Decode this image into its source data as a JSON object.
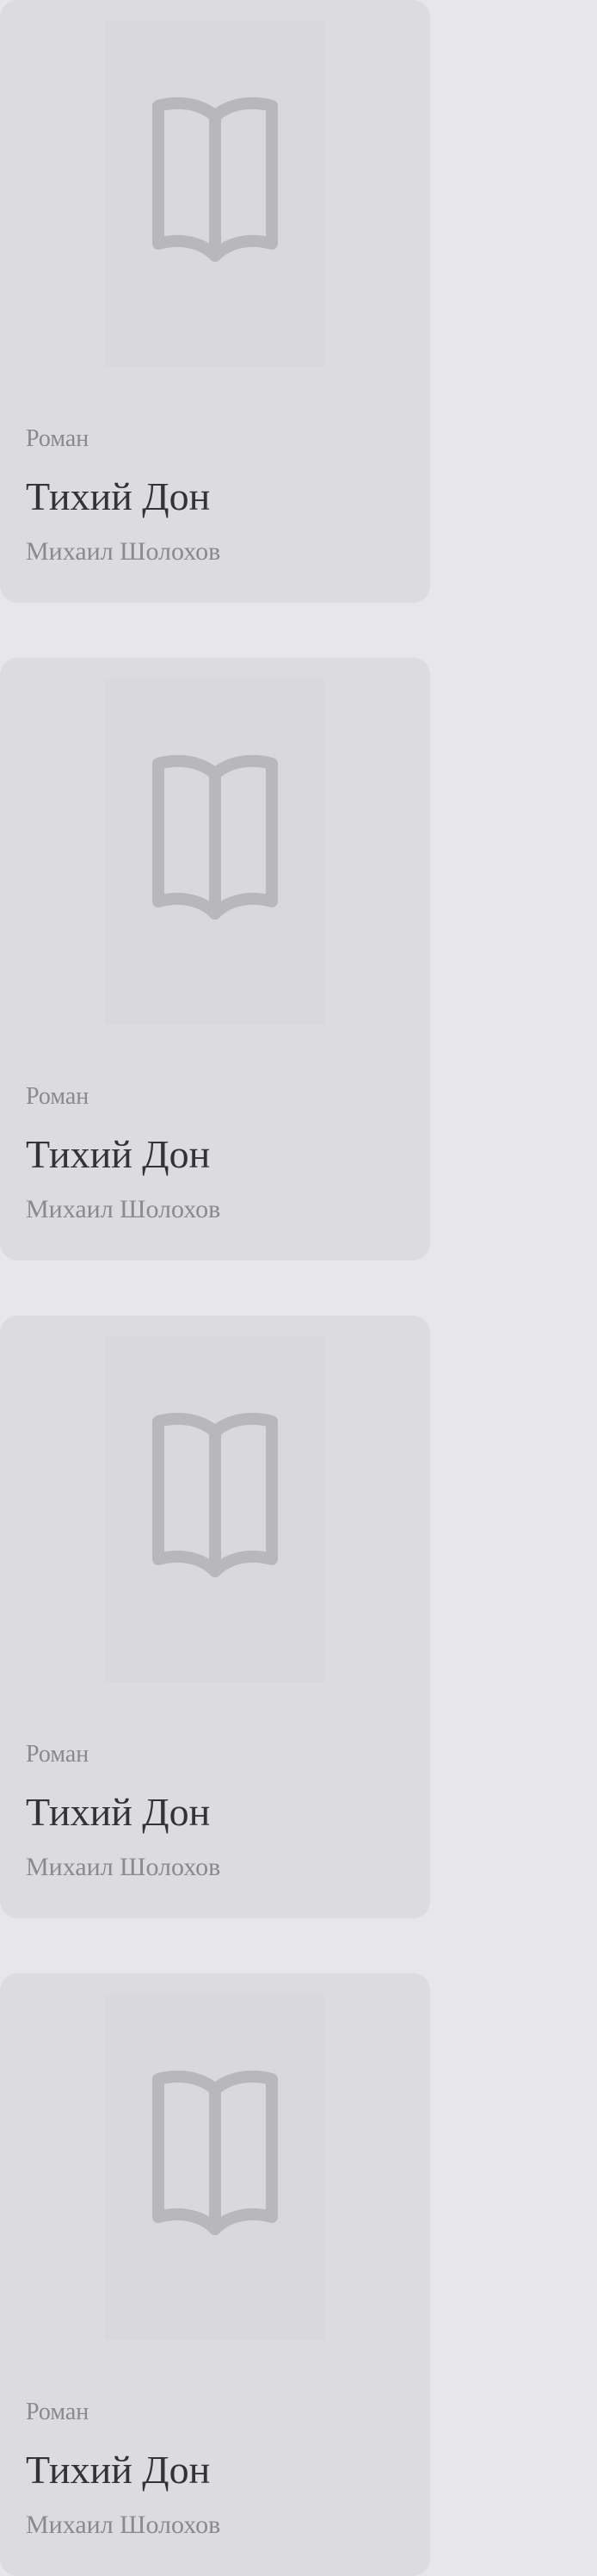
{
  "colors": {
    "background": "#e7e7e9",
    "card": "#dcdcde",
    "cover_placeholder": "#d9d9db",
    "icon": "#b8b8ba",
    "title_text": "#333335",
    "secondary_text": "#8a8a8d"
  },
  "books": [
    {
      "genre": "Роман",
      "title": "Тихий Дон",
      "author": "Михаил Шолохов",
      "cover_icon": "open-book-icon"
    },
    {
      "genre": "Роман",
      "title": "Тихий Дон",
      "author": "Михаил Шолохов",
      "cover_icon": "open-book-icon"
    },
    {
      "genre": "Роман",
      "title": "Тихий Дон",
      "author": "Михаил Шолохов",
      "cover_icon": "open-book-icon"
    },
    {
      "genre": "Роман",
      "title": "Тихий Дон",
      "author": "Михаил Шолохов",
      "cover_icon": "open-book-icon"
    }
  ]
}
